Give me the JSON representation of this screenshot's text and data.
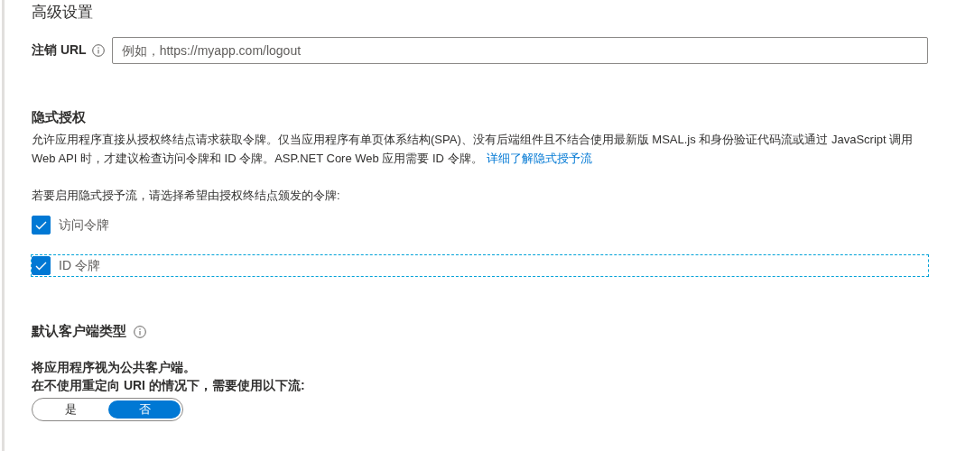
{
  "page_heading": "高级设置",
  "logout_url": {
    "label": "注销 URL",
    "placeholder": "例如，https://myapp.com/logout"
  },
  "implicit_grant": {
    "title": "隐式授权",
    "description": "允许应用程序直接从授权终结点请求获取令牌。仅当应用程序有单页体系结构(SPA)、没有后端组件且不结合使用最新版 MSAL.js 和身份验证代码流或通过 JavaScript 调用 Web API 时，才建议检查访问令牌和 ID 令牌。ASP.NET Core Web 应用需要 ID 令牌。",
    "link": "详细了解隐式授予流",
    "prompt": "若要启用隐式授予流，请选择希望由授权终结点颁发的令牌:",
    "tokens": [
      {
        "label": "访问令牌",
        "checked": true,
        "focused": false
      },
      {
        "label": "ID 令牌",
        "checked": true,
        "focused": true
      }
    ]
  },
  "client_type": {
    "title": "默认客户端类型",
    "line_1": "将应用程序视为公共客户端。",
    "line_2": "在不使用重定向 URI 的情况下，需要使用以下流:",
    "options": [
      {
        "label": "是",
        "selected": false
      },
      {
        "label": "否",
        "selected": true
      }
    ]
  }
}
